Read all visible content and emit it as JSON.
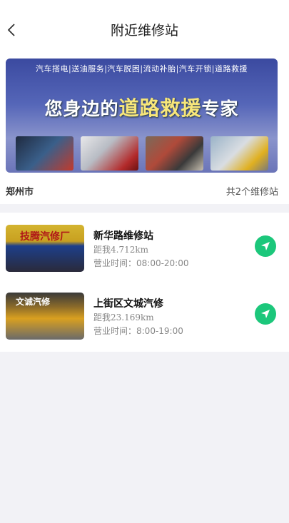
{
  "header": {
    "title": "附近维修站",
    "back_icon": "chevron-left-icon"
  },
  "banner": {
    "services": "汽车搭电|送油服务|汽车脱困|流动补胎|汽车开锁|道路救援",
    "slogan_white_1": "您身边的",
    "slogan_yellow": "道路救援",
    "slogan_white_2": "专家"
  },
  "location": {
    "city": "郑州市",
    "count_text": "共2个维修站"
  },
  "stations": [
    {
      "photo_sign": "技腾汽修厂",
      "name": "新华路维修站",
      "distance": "距我4.712km",
      "hours": "营业时间：08:00-20:00"
    },
    {
      "photo_sign": "文诚汽修",
      "name": "上街区文城汽修",
      "distance": "距我23.169km",
      "hours": "营业时间：8:00-19:00"
    }
  ],
  "colors": {
    "accent_green": "#1cc77b",
    "banner_yellow": "#f7e67a"
  },
  "icons": {
    "navigate": "navigation-arrow-icon"
  }
}
